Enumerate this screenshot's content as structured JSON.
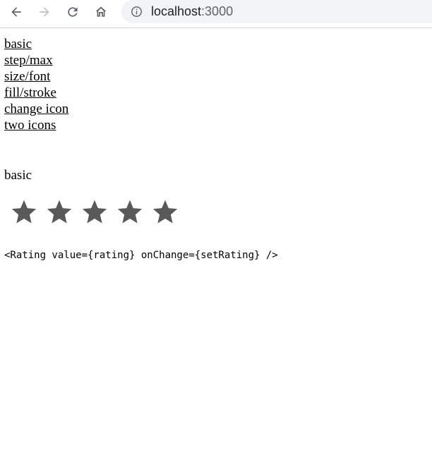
{
  "browser": {
    "url_host": "localhost",
    "url_port": ":3000",
    "icons": {
      "back": "arrow-left",
      "forward": "arrow-right",
      "reload": "circular-arrow",
      "home": "house",
      "site_info": "info-circle"
    },
    "colors": {
      "active_icon": "#5f6368",
      "disabled_icon": "#bdc1c6",
      "omnibox_bg": "#f1f3f4"
    }
  },
  "nav_links": [
    "basic",
    "step/max",
    "size/font",
    "fill/stroke",
    "change icon",
    "two icons"
  ],
  "section": {
    "title": "basic",
    "rating": {
      "max": 5,
      "filled": 0,
      "icon": "star",
      "color": "#595959"
    },
    "code": "<Rating value={rating} onChange={setRating} />"
  }
}
